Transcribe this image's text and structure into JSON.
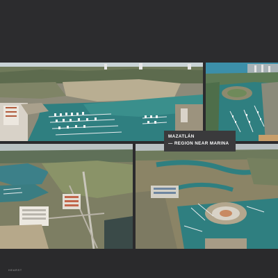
{
  "caption": {
    "line1": "MAZATLÁN",
    "line2": "— REGION NEAR MARINA"
  },
  "footer": {
    "label": "HEARST"
  },
  "photos": [
    {
      "subject": "aerial view of marina with docked boats and city skyline"
    },
    {
      "subject": "aerial view of marina island and harbor with ocean and high-rise coast"
    },
    {
      "subject": "aerial view of coastal development, lagoon and roads"
    },
    {
      "subject": "aerial view of marina canals and circular island"
    }
  ],
  "colors": {
    "background": "#2b2b2d",
    "caption_box": "#3a3a3c",
    "caption_text": "#ffffff",
    "water": "#2f7f80"
  }
}
